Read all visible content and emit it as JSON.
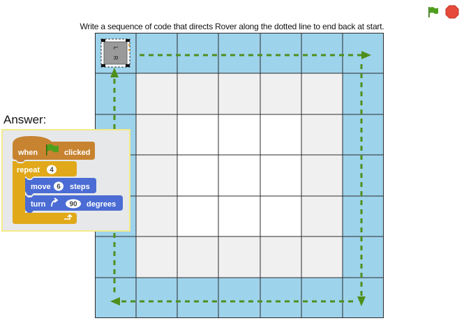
{
  "instruction": "Write a sequence of code that directs Rover along the dotted line to end back at start.",
  "answer_label": "Answer:",
  "controls": {
    "green_flag_icon": "green-flag-icon",
    "stop_icon": "stop-icon"
  },
  "grid": {
    "rows": 7,
    "cols": 7,
    "border_color": "#62b8dd",
    "inner_color": "#ffffff",
    "path_color": "#4f8f1b"
  },
  "sprite": {
    "letters": [
      "L",
      "R"
    ]
  },
  "script": {
    "hat": {
      "when": "when",
      "clicked": "clicked"
    },
    "repeat": {
      "label": "repeat",
      "count": "4"
    },
    "move": {
      "label": "move",
      "value": "6",
      "unit": "steps"
    },
    "turn": {
      "label": "turn",
      "value": "90",
      "unit": "degrees"
    },
    "colors": {
      "control": "#e1a91a",
      "events": "#c88330",
      "motion": "#4a6cd4"
    }
  }
}
